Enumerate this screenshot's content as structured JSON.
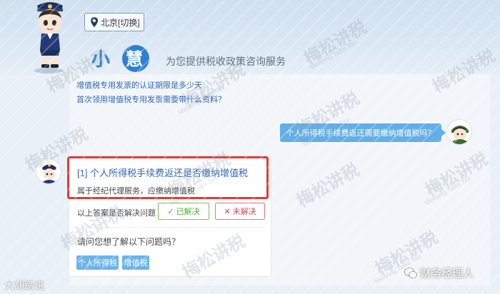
{
  "header": {
    "location_label": "北京[切换]",
    "logo_text": "小慧",
    "tagline": "为您提供税收政策咨询服务"
  },
  "previous_links": [
    "增值税专用发票的认证期限是多少天",
    "首次领用增值税专用发票需要带什么资料？"
  ],
  "user_message": "个人所得税手续费返还需要缴纳增值税吗？",
  "answer": {
    "index": "[1]",
    "title": "个人所得税手续费返还是否缴纳增值税",
    "subtitle": "属于经纪代理服务，应缴纳增值税",
    "resolve_prompt": "以上答案是否解决问题",
    "resolved_label": "已解决",
    "unresolved_label": "未解决"
  },
  "suggestions": {
    "prompt": "请问您想了解以下问题吗？",
    "tags": [
      "个人所得税",
      "增值税"
    ]
  },
  "watermarks": {
    "main": "梅松讲税",
    "sub": "Meisong Talks Tax"
  },
  "footer": {
    "left": "大胡踏说",
    "right": "财务经理人"
  },
  "colors": {
    "accent": "#63aee6",
    "highlight": "#e53935",
    "link": "#2c63b8"
  }
}
